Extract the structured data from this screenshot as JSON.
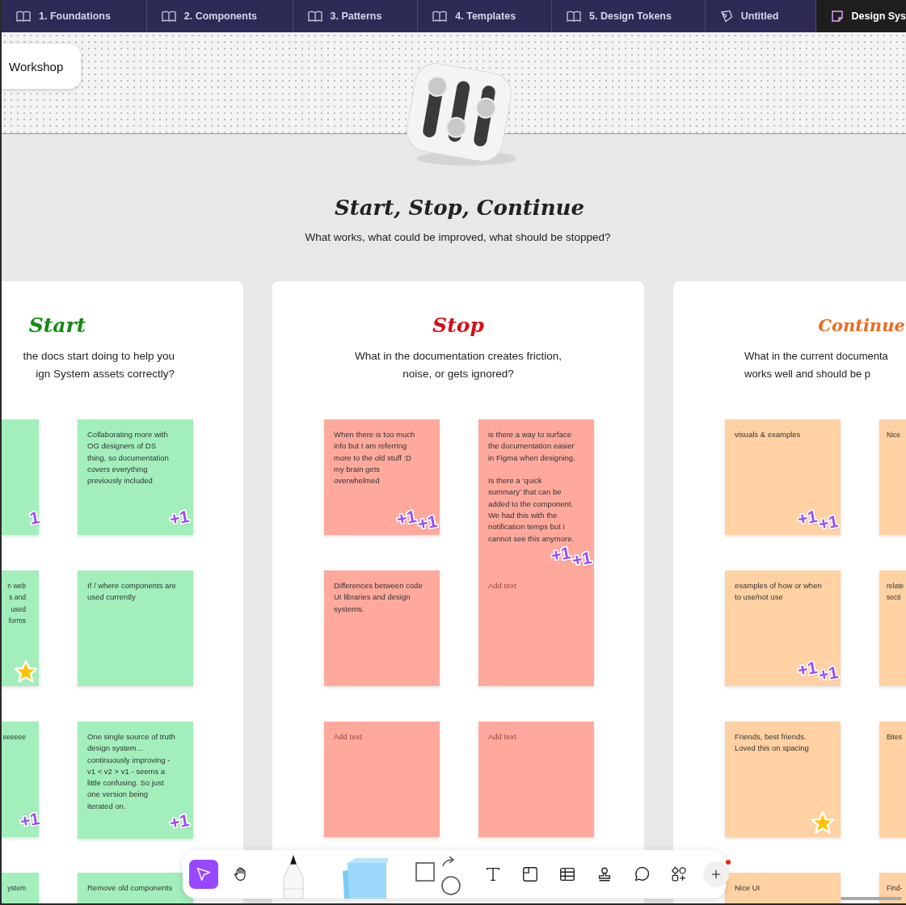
{
  "tabs": [
    {
      "label": "1. Foundations",
      "kind": "library",
      "selected": false
    },
    {
      "label": "2. Components",
      "kind": "library",
      "selected": false
    },
    {
      "label": "3. Patterns",
      "kind": "library",
      "selected": false
    },
    {
      "label": "4. Templates",
      "kind": "library",
      "selected": false
    },
    {
      "label": "5. Design Tokens",
      "kind": "library",
      "selected": false
    },
    {
      "label": "Untitled",
      "kind": "draft",
      "selected": false
    },
    {
      "label": "Design Sys",
      "kind": "board",
      "selected": true
    }
  ],
  "section_label": "Workshop",
  "title": "Start, Stop, Continue",
  "subtitle": "What works, what could be improved, what should be stopped?",
  "cards": [
    {
      "heading": "Start",
      "color": "#148a14",
      "subtitle": [
        "the docs start doing to help you",
        "ign System assets correctly?"
      ],
      "stickies": [
        {
          "stickers": [
            {
              "kind": "plus-one",
              "label": "1"
            }
          ]
        },
        {
          "text": "Collaborating more with OG designers of DS thing, so documentation covers everything previously included",
          "stickers": [
            {
              "kind": "plus-one",
              "label": "+1"
            }
          ]
        },
        {
          "text": "n web\ns and\nused\nforms",
          "stickers": [
            {
              "kind": "star"
            }
          ]
        },
        {
          "text": "If / where components are used currently"
        },
        {
          "text": "eeeeee",
          "stickers": [
            {
              "kind": "plus-one",
              "label": "+1"
            }
          ]
        },
        {
          "text": "One single source of truth design system... continuously improving - v1 < v2 > v1 - seems a little confusing. So just one version being iterated on.",
          "stickers": [
            {
              "kind": "plus-one",
              "label": "+1"
            }
          ]
        },
        {
          "text": "ystem"
        },
        {
          "text": "Remove old components"
        }
      ]
    },
    {
      "heading": "Stop",
      "color": "#d2101a",
      "subtitle": [
        "What in the documentation creates friction,",
        "noise, or gets ignored?"
      ],
      "stickies": [
        {
          "text": "When there is too much info but I am referring more to the old stuff :D my brain gets overwhelmed",
          "stickers": [
            {
              "kind": "plus-one",
              "label": "+1"
            },
            {
              "kind": "plus-one",
              "label": "+1"
            }
          ]
        },
        {
          "text": "is there a way to surface the documentation easier in Figma when designing.\n\nIs there a ‘quick summary’ that can be added to the component. We had this with the notification temps but i cannot see this anymore.",
          "stickers": [
            {
              "kind": "plus-one",
              "label": "+1"
            },
            {
              "kind": "plus-one",
              "label": "+1"
            }
          ]
        },
        {
          "text": "Differences between code UI libraries and design systems."
        },
        {
          "placeholder": "Add text"
        },
        {
          "placeholder": "Add text"
        },
        {
          "placeholder": "Add text"
        }
      ]
    },
    {
      "heading": "Continue",
      "color": "#ee6a1c",
      "subtitle": [
        "What in the current documenta",
        "works well and should be p"
      ],
      "stickies": [
        {
          "text": "visuals & examples",
          "stickers": [
            {
              "kind": "plus-one",
              "label": "+1"
            },
            {
              "kind": "plus-one",
              "label": "+1"
            }
          ]
        },
        {
          "text": "Nice"
        },
        {
          "text": "examples of how or when to use/not use",
          "stickers": [
            {
              "kind": "plus-one",
              "label": "+1"
            },
            {
              "kind": "plus-one",
              "label": "+1"
            }
          ]
        },
        {
          "text": "relate\nsecti"
        },
        {
          "text": "Friends, best friends. Loved this on spacing",
          "stickers": [
            {
              "kind": "star"
            }
          ]
        },
        {
          "text": "Bites"
        },
        {
          "text": "Nice UI"
        },
        {
          "text": "Find-"
        }
      ]
    }
  ],
  "toolbar": {
    "groups": [
      {
        "tools": [
          {
            "kind": "select",
            "selected": true
          },
          {
            "kind": "hand",
            "selected": false
          }
        ]
      },
      {
        "tools": [
          {
            "kind": "marker",
            "selected": false
          },
          {
            "kind": "sticky-notes",
            "selected": false
          },
          {
            "kind": "shapes",
            "selected": false
          }
        ]
      },
      {
        "tools": [
          {
            "kind": "text",
            "selected": false
          },
          {
            "kind": "section",
            "selected": false
          },
          {
            "kind": "table",
            "selected": false
          },
          {
            "kind": "stamp",
            "selected": false
          },
          {
            "kind": "comment",
            "selected": false
          },
          {
            "kind": "widgets",
            "selected": false
          },
          {
            "kind": "plus",
            "selected": false,
            "notification": true
          }
        ]
      }
    ]
  }
}
